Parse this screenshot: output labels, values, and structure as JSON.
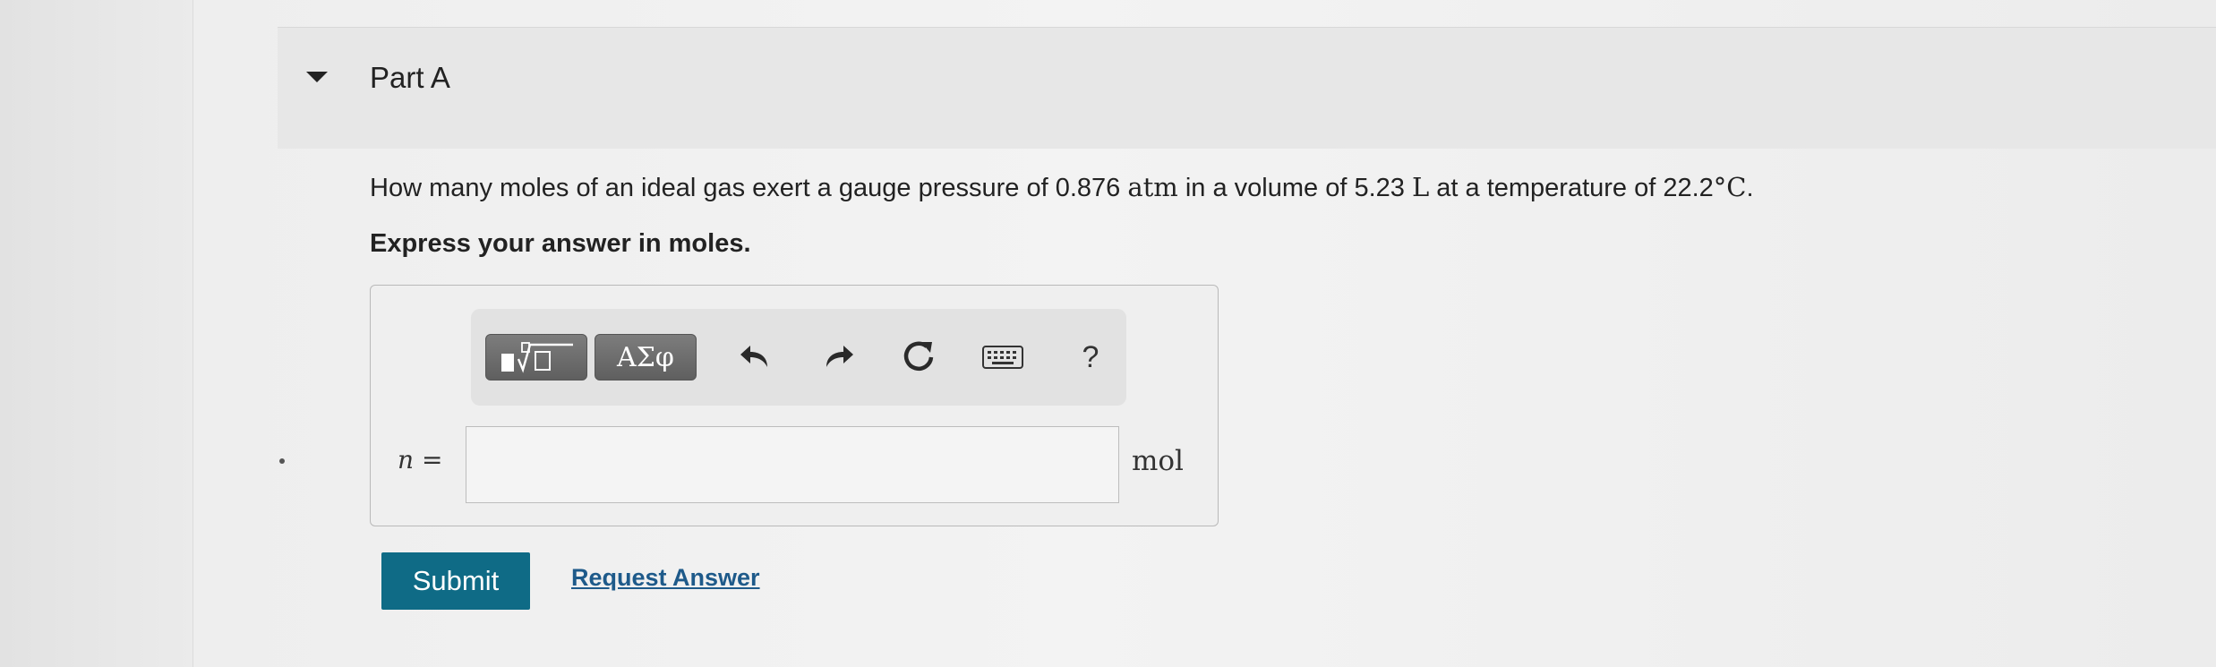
{
  "part": {
    "title": "Part A"
  },
  "question": {
    "text_1": "How many moles of an ideal gas exert a gauge pressure of 0.876 ",
    "unit_pressure": "atm",
    "text_2": " in a volume of 5.23 ",
    "unit_volume": "L",
    "text_3": " at a temperature of 22.2",
    "unit_temperature": "°C",
    "text_4": "."
  },
  "instruction": "Express your answer in moles.",
  "toolbar": {
    "greek_label": "ΑΣφ",
    "help_label": "?",
    "icons": [
      "templates-icon",
      "undo-icon",
      "redo-icon",
      "reset-icon",
      "keyboard-icon"
    ]
  },
  "answer": {
    "variable": "n",
    "equals": " =",
    "value": "",
    "unit": "mol"
  },
  "actions": {
    "submit_label": "Submit",
    "request_label": "Request Answer"
  },
  "colors": {
    "submit_bg": "#0f6b86",
    "link": "#1e5a8a",
    "toolbar_button": "#6b6b6b"
  }
}
